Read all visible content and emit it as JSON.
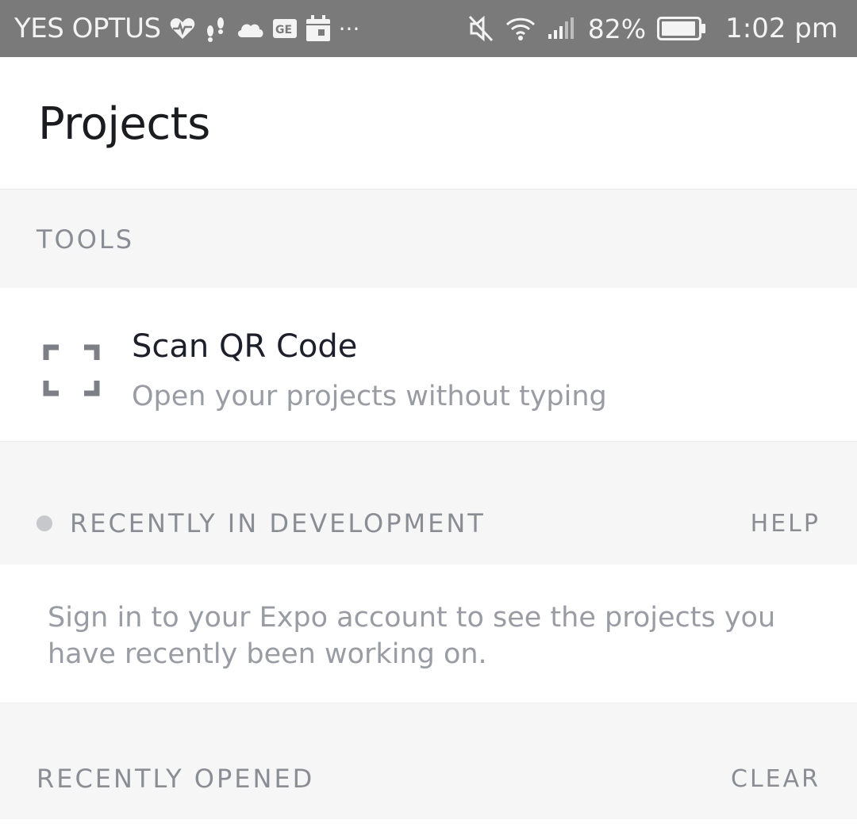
{
  "status_bar": {
    "carrier": "YES OPTUS",
    "battery_percent": "82%",
    "time": "1:02 pm",
    "icons": [
      "heart-icon",
      "footsteps-icon",
      "cloud-icon",
      "ge-card-icon",
      "calendar-icon",
      "more-icon",
      "mute-icon",
      "wifi-icon",
      "signal-icon",
      "battery-icon"
    ],
    "more": "···",
    "ge_label": "GE"
  },
  "header": {
    "title": "Projects"
  },
  "tools": {
    "section_label": "TOOLS",
    "qr": {
      "title": "Scan QR Code",
      "subtitle": "Open your projects without typing",
      "icon": "qr-scan-icon"
    }
  },
  "recent_dev": {
    "section_label": "RECENTLY IN DEVELOPMENT",
    "action": "HELP",
    "message": "Sign in to your Expo account to see the projects you have recently been working on."
  },
  "recent_opened": {
    "section_label": "RECENTLY OPENED",
    "action": "CLEAR"
  },
  "colors": {
    "status_bar_bg": "#7a7a7a",
    "page_bg": "#f6f6f7",
    "card_bg": "#ffffff",
    "muted_text": "#8a8d94"
  }
}
